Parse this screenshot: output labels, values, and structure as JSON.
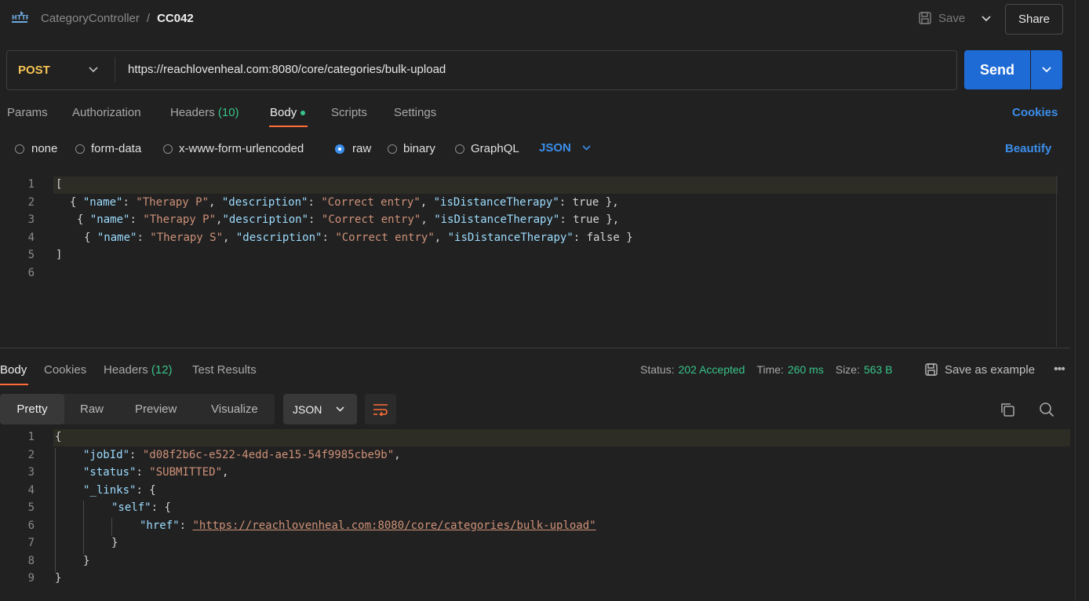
{
  "header": {
    "app_icon": "http-icon",
    "app_icon_text": "HTTP",
    "breadcrumb_parent": "CategoryController",
    "breadcrumb_sep": "/",
    "breadcrumb_current": "CC042",
    "save_label": "Save",
    "share_label": "Share"
  },
  "request": {
    "method": "POST",
    "url": "https://reachlovenheal.com:8080/core/categories/bulk-upload",
    "send_label": "Send"
  },
  "request_tabs": {
    "params": "Params",
    "authorization": "Authorization",
    "headers": "Headers",
    "headers_count": "(10)",
    "body": "Body",
    "scripts": "Scripts",
    "settings": "Settings",
    "cookies": "Cookies"
  },
  "body_types": {
    "none": "none",
    "form_data": "form-data",
    "urlencoded": "x-www-form-urlencoded",
    "raw": "raw",
    "binary": "binary",
    "graphql": "GraphQL",
    "format": "JSON",
    "beautify": "Beautify",
    "selected": "raw"
  },
  "request_body": {
    "line_numbers": [
      "1",
      "2",
      "3",
      "4",
      "5",
      "6"
    ],
    "lines": [
      "[",
      "{ \"name\": \"Therapy P\", \"description\": \"Correct entry\", \"isDistanceTherapy\": true },",
      "{ \"name\": \"Therapy P\",\"description\": \"Correct entry\", \"isDistanceTherapy\": true },",
      "{ \"name\": \"Therapy S\", \"description\": \"Correct entry\", \"isDistanceTherapy\": false }",
      "]",
      ""
    ]
  },
  "response_tabs": {
    "body": "Body",
    "cookies": "Cookies",
    "headers": "Headers",
    "headers_count": "(12)",
    "test_results": "Test Results"
  },
  "response_meta": {
    "status_label": "Status:",
    "status_value": "202 Accepted",
    "time_label": "Time:",
    "time_value": "260 ms",
    "size_label": "Size:",
    "size_value": "563 B",
    "save_example": "Save as example"
  },
  "response_view": {
    "pretty": "Pretty",
    "raw": "Raw",
    "preview": "Preview",
    "visualize": "Visualize",
    "format": "JSON"
  },
  "response_body": {
    "line_numbers": [
      "1",
      "2",
      "3",
      "4",
      "5",
      "6",
      "7",
      "8",
      "9"
    ],
    "open": "{",
    "jobId_key": "\"jobId\"",
    "jobId_val": "\"d08f2b6c-e522-4edd-ae15-54f9985cbe9b\"",
    "status_key": "\"status\"",
    "status_val": "\"SUBMITTED\"",
    "links_key": "\"_links\"",
    "self_key": "\"self\"",
    "href_key": "\"href\"",
    "href_val": "\"https://reachlovenheal.com:8080/core/categories/bulk-upload\"",
    "close": "}"
  },
  "colors": {
    "send": "#1f6bd6",
    "method": "#f5c453",
    "accent_tab": "#ff6c37",
    "status_green": "#38c48a",
    "link_blue": "#3b8eea"
  }
}
